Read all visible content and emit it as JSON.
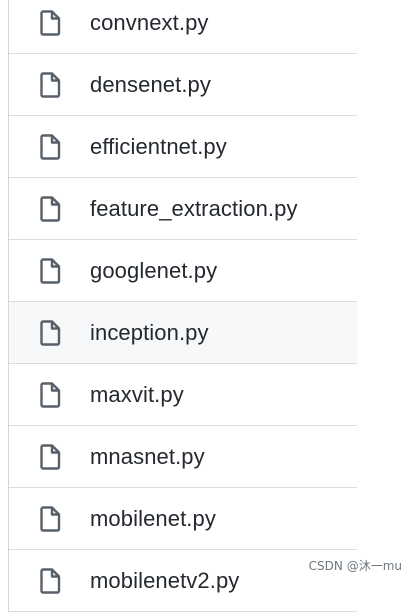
{
  "files": [
    {
      "name": "convnext.py",
      "icon": "file-icon"
    },
    {
      "name": "densenet.py",
      "icon": "file-icon"
    },
    {
      "name": "efficientnet.py",
      "icon": "file-icon"
    },
    {
      "name": "feature_extraction.py",
      "icon": "file-icon"
    },
    {
      "name": "googlenet.py",
      "icon": "file-icon"
    },
    {
      "name": "inception.py",
      "icon": "file-icon",
      "highlighted": true
    },
    {
      "name": "maxvit.py",
      "icon": "file-icon"
    },
    {
      "name": "mnasnet.py",
      "icon": "file-icon"
    },
    {
      "name": "mobilenet.py",
      "icon": "file-icon"
    },
    {
      "name": "mobilenetv2.py",
      "icon": "file-icon"
    }
  ],
  "watermark": "CSDN @沐一mu",
  "colors": {
    "text": "#24292f",
    "icon": "#57606a",
    "divider": "#d8dee4",
    "highlight_bg": "#f6f8fa"
  }
}
